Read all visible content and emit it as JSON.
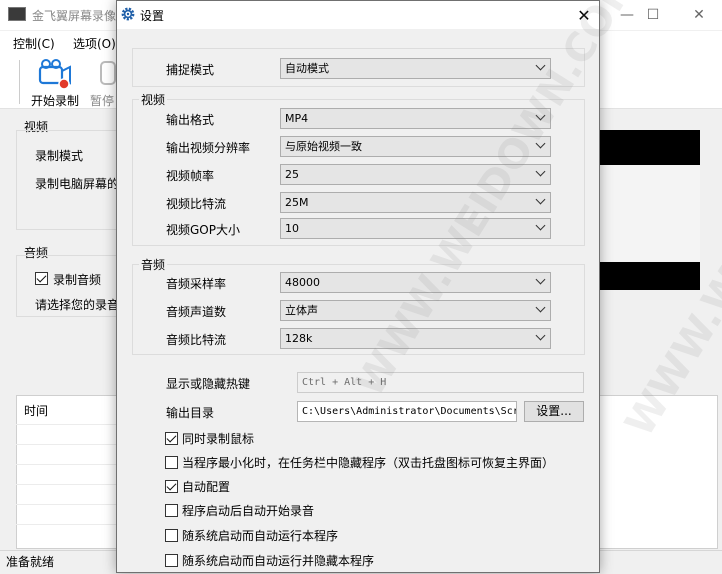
{
  "main_window": {
    "title": "金飞翼屏幕录像",
    "menu": [
      "控制(C)",
      "选项(O)"
    ],
    "toolbar": {
      "start_record": "开始录制",
      "pause": "暂停"
    },
    "video_group": {
      "label": "视频",
      "record_mode": "录制模式",
      "record_screen": "录制电脑屏幕的"
    },
    "audio_group": {
      "label": "音频",
      "record_audio": "录制音频",
      "record_audio_checked": true,
      "choose_device": "请选择您的录音"
    },
    "timeline_header": "时间",
    "status": "准备就绪",
    "window_buttons": {
      "minimize": "—",
      "maximize": "☐",
      "close": "✕"
    }
  },
  "dialog": {
    "title": "设置",
    "close": "✕",
    "capture_mode": {
      "label": "捕捉模式",
      "value": "自动模式"
    },
    "video": {
      "legend": "视频",
      "format": {
        "label": "输出格式",
        "value": "MP4"
      },
      "resolution": {
        "label": "输出视频分辨率",
        "value": "与原始视频一致"
      },
      "fps": {
        "label": "视频帧率",
        "value": "25"
      },
      "bitrate": {
        "label": "视频比特流",
        "value": "25M"
      },
      "gop": {
        "label": "视频GOP大小",
        "value": "10"
      }
    },
    "audio": {
      "legend": "音频",
      "sample_rate": {
        "label": "音频采样率",
        "value": "48000"
      },
      "channels": {
        "label": "音频声道数",
        "value": "立体声"
      },
      "bitrate": {
        "label": "音频比特流",
        "value": "128k"
      }
    },
    "hotkey": {
      "label": "显示或隐藏热键",
      "value": "Ctrl + Alt + H"
    },
    "output_dir": {
      "label": "输出目录",
      "value": "C:\\Users\\Administrator\\Documents\\Scr",
      "button": "设置..."
    },
    "options": [
      {
        "label": "同时录制鼠标",
        "checked": true
      },
      {
        "label": "当程序最小化时，在任务栏中隐藏程序（双击托盘图标可恢复主界面）",
        "checked": false
      },
      {
        "label": "自动配置",
        "checked": true
      },
      {
        "label": "程序启动后自动开始录音",
        "checked": false
      },
      {
        "label": "随系统启动而自动运行本程序",
        "checked": false
      },
      {
        "label": "随系统启动而自动运行并隐藏本程序",
        "checked": false
      }
    ]
  },
  "watermark": "WWW.WEIDOWN.COM"
}
